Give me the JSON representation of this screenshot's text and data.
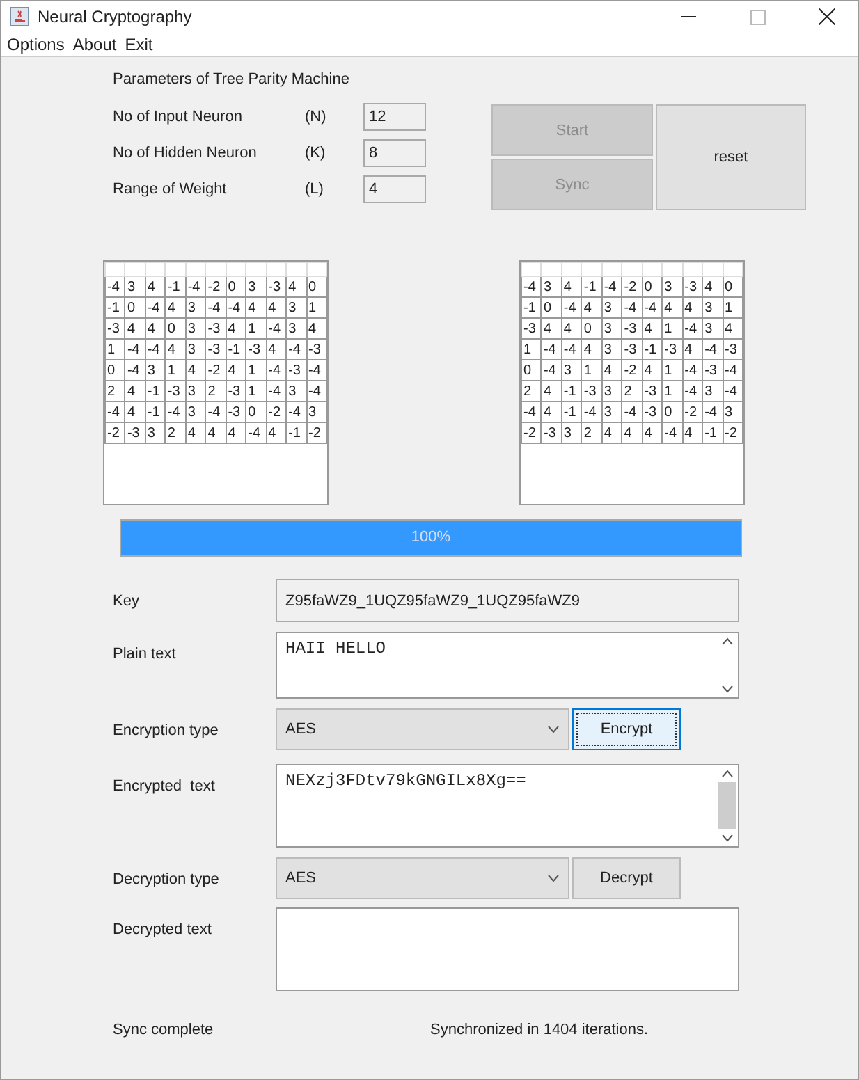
{
  "window": {
    "title": "Neural Cryptography"
  },
  "menu": [
    "Options",
    "About",
    "Exit"
  ],
  "parameters": {
    "title": "Parameters of Tree Parity Machine",
    "fields": [
      {
        "label": "No of Input Neuron",
        "symbol": "(N)",
        "value": "12"
      },
      {
        "label": "No of Hidden Neuron",
        "symbol": "(K)",
        "value": "8"
      },
      {
        "label": "Range of Weight",
        "symbol": "(L)",
        "value": "4"
      }
    ]
  },
  "buttons": [
    {
      "label": "Start",
      "disabled": true
    },
    {
      "label": "Sync",
      "disabled": true
    },
    {
      "label": "reset",
      "disabled": false
    }
  ],
  "weight_tables": [
    {
      "rows": [
        [
          "-4",
          "3",
          "4",
          "-1",
          "-4",
          "-2",
          "0",
          "3",
          "-3",
          "4",
          "0"
        ],
        [
          "-1",
          "0",
          "-4",
          "4",
          "3",
          "-4",
          "-4",
          "4",
          "4",
          "3",
          "1"
        ],
        [
          "-3",
          "4",
          "4",
          "0",
          "3",
          "-3",
          "4",
          "1",
          "-4",
          "3",
          "4"
        ],
        [
          "1",
          "-4",
          "-4",
          "4",
          "3",
          "-3",
          "-1",
          "-3",
          "4",
          "-4",
          "-3"
        ],
        [
          "0",
          "-4",
          "3",
          "1",
          "4",
          "-2",
          "4",
          "1",
          "-4",
          "-3",
          "-4"
        ],
        [
          "2",
          "4",
          "-1",
          "-3",
          "3",
          "2",
          "-3",
          "1",
          "-4",
          "3",
          "-4"
        ],
        [
          "-4",
          "4",
          "-1",
          "-4",
          "3",
          "-4",
          "-3",
          "0",
          "-2",
          "-4",
          "3"
        ],
        [
          "-2",
          "-3",
          "3",
          "2",
          "4",
          "4",
          "4",
          "-4",
          "4",
          "-1",
          "-2"
        ]
      ]
    },
    {
      "rows": [
        [
          "-4",
          "3",
          "4",
          "-1",
          "-4",
          "-2",
          "0",
          "3",
          "-3",
          "4",
          "0"
        ],
        [
          "-1",
          "0",
          "-4",
          "4",
          "3",
          "-4",
          "-4",
          "4",
          "4",
          "3",
          "1"
        ],
        [
          "-3",
          "4",
          "4",
          "0",
          "3",
          "-3",
          "4",
          "1",
          "-4",
          "3",
          "4"
        ],
        [
          "1",
          "-4",
          "-4",
          "4",
          "3",
          "-3",
          "-1",
          "-3",
          "4",
          "-4",
          "-3"
        ],
        [
          "0",
          "-4",
          "3",
          "1",
          "4",
          "-2",
          "4",
          "1",
          "-4",
          "-3",
          "-4"
        ],
        [
          "2",
          "4",
          "-1",
          "-3",
          "3",
          "2",
          "-3",
          "1",
          "-4",
          "3",
          "-4"
        ],
        [
          "-4",
          "4",
          "-1",
          "-4",
          "3",
          "-4",
          "-3",
          "0",
          "-2",
          "-4",
          "3"
        ],
        [
          "-2",
          "-3",
          "3",
          "2",
          "4",
          "4",
          "4",
          "-4",
          "4",
          "-1",
          "-2"
        ]
      ]
    }
  ],
  "progress": {
    "level": 1,
    "text": "100%"
  },
  "key": {
    "label": "Key",
    "value": "Z95faWZ9_1UQZ95faWZ9_1UQZ95faWZ9"
  },
  "plain_text": {
    "label": "Plain text",
    "value": "HAII HELLO"
  },
  "encryption": {
    "label": "Encryption type",
    "value": "AES",
    "button": "Encrypt",
    "focused": true
  },
  "encrypted_text": {
    "label": "Encrypted  text",
    "value": "NEXzj3FDtv79kGNGILx8Xg=="
  },
  "decryption": {
    "label": "Decryption type",
    "value": "AES",
    "button": "Decrypt",
    "focused": false
  },
  "decrypted_text": {
    "label": "Decrypted text"
  },
  "status_bar": {
    "left": "Sync complete",
    "right": "Synchronized in 1404 iterations."
  }
}
